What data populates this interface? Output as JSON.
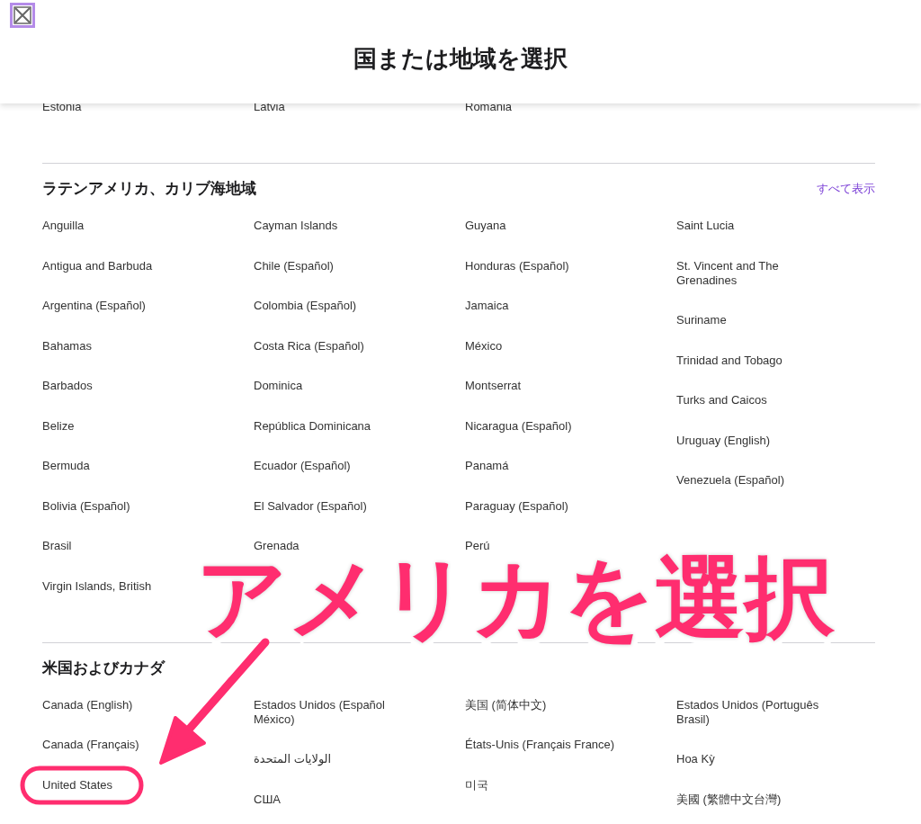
{
  "header": {
    "title": "国または地域を選択"
  },
  "sections": [
    {
      "columns": [
        [
          "Estonia"
        ],
        [
          "Latvia"
        ],
        [
          "Romania"
        ]
      ]
    },
    {
      "heading": "ラテンアメリカ、カリブ海地域",
      "link": "すべて表示",
      "columns": [
        [
          "Anguilla",
          "Antigua and Barbuda",
          "Argentina (Español)",
          "Bahamas",
          "Barbados",
          "Belize",
          "Bermuda",
          "Bolivia (Español)",
          "Brasil",
          "Virgin Islands, British"
        ],
        [
          "Cayman Islands",
          "Chile (Español)",
          "Colombia (Español)",
          "Costa Rica (Español)",
          "Dominica",
          "República Dominicana",
          "Ecuador (Español)",
          "El Salvador (Español)",
          "Grenada"
        ],
        [
          "Guyana",
          "Honduras (Español)",
          "Jamaica",
          "México",
          "Montserrat",
          "Nicaragua (Español)",
          "Panamá",
          "Paraguay (Español)",
          "Perú"
        ],
        [
          "Saint Lucia",
          "St. Vincent and The Grenadines",
          "Suriname",
          "Trinidad and Tobago",
          "Turks and Caicos",
          "Uruguay (English)",
          "Venezuela (Español)"
        ]
      ]
    },
    {
      "heading": "米国およびカナダ",
      "columns": [
        [
          {
            "label": "Canada (English)",
            "circled": false
          },
          {
            "label": "Canada (Français)",
            "circled": false
          },
          {
            "label": "United States",
            "circled": true
          }
        ],
        [
          {
            "label": "Estados Unidos (Español México)",
            "circled": false
          },
          {
            "label": "الولايات المتحدة",
            "circled": false
          },
          {
            "label": "США",
            "circled": false
          }
        ],
        [
          {
            "label": "美国 (简体中文)",
            "circled": false
          },
          {
            "label": "États-Unis (Français France)",
            "circled": false
          },
          {
            "label": "미국",
            "circled": false
          }
        ],
        [
          {
            "label": "Estados Unidos (Português Brasil)",
            "circled": false
          },
          {
            "label": "Hoa Kỳ",
            "circled": false
          },
          {
            "label": "美國 (繁體中文台灣)",
            "circled": false
          }
        ]
      ]
    }
  ],
  "annotation": {
    "text": "アメリカを選択"
  }
}
